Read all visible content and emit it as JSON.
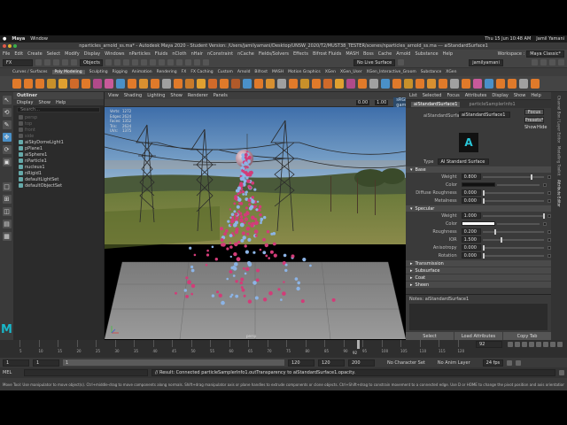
{
  "mac_menu": {
    "app": "Maya",
    "window": "Window",
    "clock": "Thu 15 Jun  10:48 AM",
    "user": "Jamil Yamani"
  },
  "title": "nparticles_arnold_ss.ma* - Autodesk Maya 2020 - Student Version: /Users/jamilyamani/Desktop/UNSW_2020/T2/MUST38_TESTER/scenes/nparticles_arnold_ss.ma  ---  aiStandardSurface1",
  "main_menu": [
    "File",
    "Edit",
    "Create",
    "Select",
    "Modify",
    "Display",
    "Windows",
    "nParticles",
    "Fluids",
    "nCloth",
    "nHair",
    "nConstraint",
    "nCache",
    "Fields/Solvers",
    "Effects",
    "Bifrost Fluids",
    "MASH",
    "Boss",
    "Cache",
    "Arnold",
    "Substance",
    "Help"
  ],
  "workspace": {
    "label": "Workspace :",
    "value": "Maya Classic*"
  },
  "status_line": {
    "mode": "FX",
    "objects": "Objects",
    "no_live": "No Live Surface",
    "user": "jamilyamani"
  },
  "shelf_tabs": [
    "Curves / Surfaces",
    "Poly Modeling",
    "Sculpting",
    "Rigging",
    "Animation",
    "Rendering",
    "FX",
    "FX Caching",
    "Custom",
    "Arnold",
    "Bifrost",
    "MASH",
    "Motion Graphics",
    "XGen",
    "XGen_User",
    "XGen_Interactive_Groom",
    "Substance",
    "XGen"
  ],
  "shelf_active": "Poly Modeling",
  "shelf_icon_colors": [
    "#e07a2a",
    "#e07a2a",
    "#e07a2a",
    "#c8902a",
    "#e0a030",
    "#d06a2a",
    "#e07a2a",
    "#b04a8a",
    "#c85a9a",
    "#4a90c8",
    "#e07a2a",
    "#d89030",
    "#e07a2a",
    "#a0a0a0",
    "#e07a2a",
    "#c87a2a",
    "#e0a030",
    "#d06a2a",
    "#e07a2a",
    "#b05a2a",
    "#4a90c8",
    "#e07a2a",
    "#d89030",
    "#a0a0a0",
    "#e07a2a",
    "#c8902a",
    "#e07a2a",
    "#d06a2a",
    "#e0a030",
    "#b04a8a",
    "#e07a2a",
    "#a0a0a0",
    "#4a90c8",
    "#e07a2a",
    "#c8902a",
    "#e07a2a",
    "#d89030",
    "#e07a2a",
    "#a0a0a0",
    "#e07a2a",
    "#c85a9a",
    "#4a90c8",
    "#e07a2a",
    "#e07a2a",
    "#a0a0a0",
    "#e07a2a"
  ],
  "outliner": {
    "title": "Outliner",
    "menu": [
      "Display",
      "Show",
      "Help"
    ],
    "search": "Search...",
    "items": [
      {
        "label": "persp",
        "dim": true
      },
      {
        "label": "top",
        "dim": true
      },
      {
        "label": "front",
        "dim": true
      },
      {
        "label": "side",
        "dim": true
      },
      {
        "label": "aiSkyDomeLight1",
        "dim": false
      },
      {
        "label": "pPlane1",
        "dim": false
      },
      {
        "label": "aiSphere1",
        "dim": false
      },
      {
        "label": "nParticle1",
        "dim": false
      },
      {
        "label": "nucleus1",
        "dim": false
      },
      {
        "label": "nRigid1",
        "dim": false
      },
      {
        "label": "defaultLightSet",
        "dim": false
      },
      {
        "label": "defaultObjectSet",
        "dim": false
      }
    ]
  },
  "panel_menu": [
    "View",
    "Shading",
    "Lighting",
    "Show",
    "Renderer",
    "Panels"
  ],
  "panel_toolbar": {
    "val1": "0.00",
    "val2": "1.00",
    "colorspace": "sRGB gamma"
  },
  "hud": [
    {
      "k": "Verts:",
      "v": "1272"
    },
    {
      "k": "Edges:",
      "v": "2624"
    },
    {
      "k": "Faces:",
      "v": "1352"
    },
    {
      "k": "Tris:",
      "v": "2624"
    },
    {
      "k": "UVs:",
      "v": "1375"
    }
  ],
  "camera_label": "persp",
  "attribute_editor": {
    "menu": [
      "List",
      "Selected",
      "Focus",
      "Attributes",
      "Display",
      "Show",
      "Help"
    ],
    "tabs": [
      "aiStandardSurface1",
      "particleSamplerInfo1"
    ],
    "node_label": "aiStandardSurface:",
    "node_value": "aiStandardSurface1",
    "focus": "Focus",
    "presets": "Presets*",
    "show": "Show",
    "hide": "Hide",
    "type_label": "Type",
    "type_value": "AI Standard Surface",
    "sections": {
      "base": "Base",
      "specular": "Specular",
      "collapsed": [
        "Transmission",
        "Subsurface",
        "Coat",
        "Sheen"
      ]
    },
    "base_rows": [
      {
        "label": "Weight",
        "value": "0.800",
        "pos": 0.8
      },
      {
        "label": "Color",
        "value": "",
        "color": "#111111"
      },
      {
        "label": "Diffuse Roughness",
        "value": "0.000",
        "pos": 0.0
      },
      {
        "label": "Metalness",
        "value": "0.000",
        "pos": 0.0
      }
    ],
    "spec_rows": [
      {
        "label": "Weight",
        "value": "1.000",
        "pos": 1.0
      },
      {
        "label": "Color",
        "value": "",
        "color": "#ffffff"
      },
      {
        "label": "Roughness",
        "value": "0.200",
        "pos": 0.2
      },
      {
        "label": "IOR",
        "value": "1.500",
        "pos": 0.3
      },
      {
        "label": "Anisotropy",
        "value": "0.000",
        "pos": 0.0
      },
      {
        "label": "Rotation",
        "value": "0.000",
        "pos": 0.0
      }
    ],
    "notes": "Notes:  aiStandardSurface1",
    "buttons": [
      "Select",
      "Load Attributes",
      "Copy Tab"
    ]
  },
  "side_tabs": [
    "Channel Box / Layer Editor",
    "Modelling Toolkit",
    "Attribute Editor"
  ],
  "timeline": {
    "ticks": [
      "5",
      "10",
      "15",
      "20",
      "25",
      "30",
      "35",
      "40",
      "45",
      "50",
      "55",
      "60",
      "65",
      "70",
      "75",
      "80",
      "85",
      "90",
      "95",
      "100",
      "105",
      "110",
      "115",
      "120"
    ],
    "current": "92",
    "current_field": "92"
  },
  "range": {
    "start": "1",
    "start2": "1",
    "bar_start": "1",
    "end": "120",
    "end2": "120",
    "end3": "200",
    "character": "No Character Set",
    "anim_layer": "No Anim Layer",
    "fps": "24 fps"
  },
  "command": {
    "lang": "MEL",
    "result": "// Result: Connected particleSamplerInfo1.outTransparency to aiStandardSurface1.opacity."
  },
  "help_line": "Move Tool: Use manipulator to move object(s). Ctrl+middle-drag to move components along normals. Shift+drag manipulator axis or plane handles to extrude components or clone objects. Ctrl+Shift+drag to constrain movement to a connected edge. Use D or HOME to change the pivot position and axis orientation.",
  "particles_pink_color": "#d23c78",
  "particles_blue_color": "#8cb4e6"
}
